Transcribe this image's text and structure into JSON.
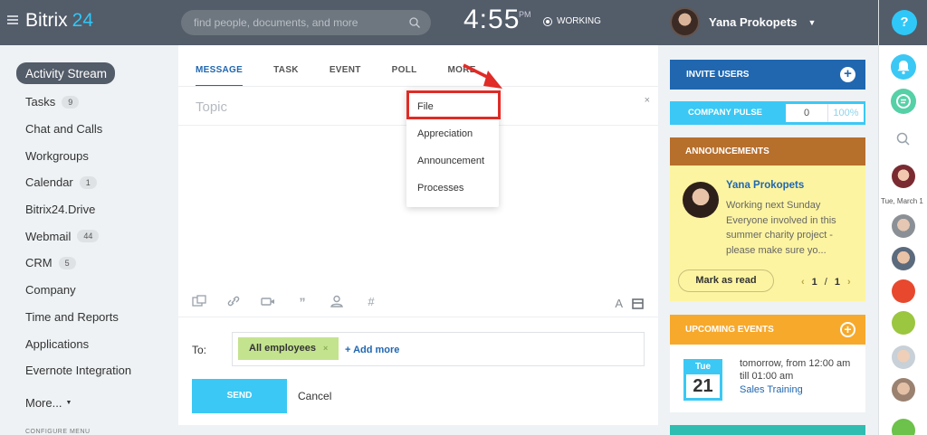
{
  "header": {
    "logo_text": "Bitrix",
    "logo_num": "24",
    "search_placeholder": "find people, documents, and more",
    "time": "4:55",
    "ampm": "PM",
    "status": "WORKING",
    "user_name": "Yana Prokopets"
  },
  "rail": {
    "help": "?",
    "date": "Tue, March 1"
  },
  "nav": {
    "items": [
      {
        "label": "Activity Stream"
      },
      {
        "label": "Tasks",
        "badge": "9"
      },
      {
        "label": "Chat and Calls"
      },
      {
        "label": "Workgroups"
      },
      {
        "label": "Calendar",
        "badge": "1"
      },
      {
        "label": "Bitrix24.Drive"
      },
      {
        "label": "Webmail",
        "badge": "44"
      },
      {
        "label": "CRM",
        "badge": "5"
      },
      {
        "label": "Company"
      },
      {
        "label": "Time and Reports"
      },
      {
        "label": "Applications"
      },
      {
        "label": "Evernote Integration"
      },
      {
        "label": "More..."
      }
    ],
    "configure": "CONFIGURE MENU"
  },
  "post": {
    "tabs": [
      "MESSAGE",
      "TASK",
      "EVENT",
      "POLL",
      "MORE"
    ],
    "topic_placeholder": "Topic",
    "close": "×",
    "to_label": "To:",
    "chip": "All employees",
    "add_more": "+ Add more",
    "send": "SEND",
    "cancel": "Cancel",
    "dropdown": [
      "File",
      "Appreciation",
      "Announcement",
      "Processes"
    ]
  },
  "widgets": {
    "invite": "INVITE USERS",
    "pulse_label": "COMPANY PULSE",
    "pulse_value": "0",
    "pulse_pct": "100%",
    "announce_title": "ANNOUNCEMENTS",
    "announce_author": "Yana Prokopets",
    "announce_text": "Working next Sunday Everyone involved in this summer charity project - please make sure yo...",
    "mark_read": "Mark as read",
    "pager_current": "1",
    "pager_sep": "/",
    "pager_total": "1",
    "events_title": "UPCOMING EVENTS",
    "event_day": "Tue",
    "event_date": "21",
    "event_time": "tomorrow, from 12:00 am till 01:00 am",
    "event_name": "Sales Training"
  },
  "colors": {
    "header": "#535c69",
    "accent_blue": "#2067b0",
    "cyan": "#3bc8f5",
    "announce": "#b76f2c",
    "events": "#f7a92c",
    "highlight": "#e02b26"
  }
}
